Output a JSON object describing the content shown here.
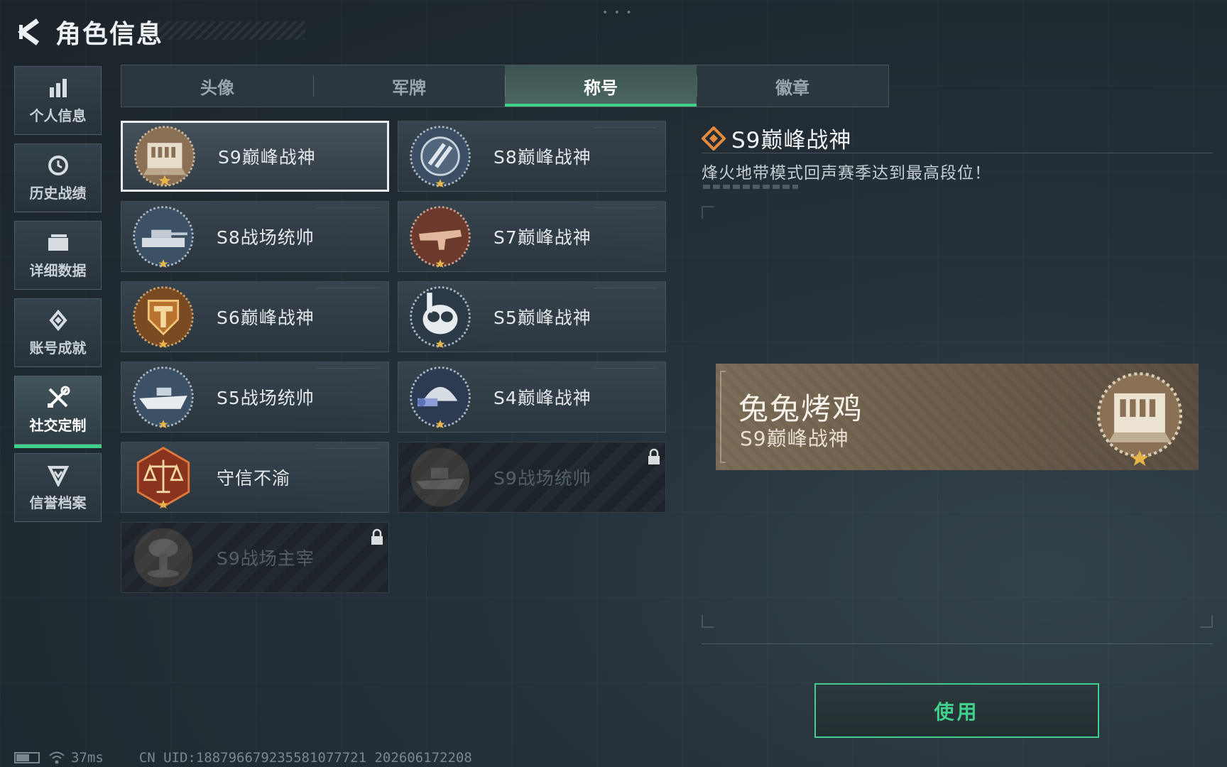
{
  "header": {
    "title": "角色信息"
  },
  "sidebar": {
    "items": [
      {
        "label": "个人信息",
        "icon": "bar-chart-icon"
      },
      {
        "label": "历史战绩",
        "icon": "clock-icon"
      },
      {
        "label": "详细数据",
        "icon": "folder-icon"
      },
      {
        "label": "账号成就",
        "icon": "medal-icon"
      },
      {
        "label": "社交定制",
        "icon": "tools-icon",
        "active": true
      },
      {
        "label": "信誉档案",
        "icon": "shield-check-icon"
      }
    ]
  },
  "tabs": [
    {
      "label": "头像"
    },
    {
      "label": "军牌"
    },
    {
      "label": "称号",
      "active": true
    },
    {
      "label": "徽章"
    }
  ],
  "titles": [
    {
      "label": "S9巅峰战神",
      "badge": "dam-badge-icon",
      "selected": true,
      "locked": false
    },
    {
      "label": "S8巅峰战神",
      "badge": "slash-emblem-badge-icon",
      "selected": false,
      "locked": false
    },
    {
      "label": "S8战场统帅",
      "badge": "tank-badge-icon",
      "selected": false,
      "locked": false
    },
    {
      "label": "S7巅峰战神",
      "badge": "rifle-badge-icon",
      "selected": false,
      "locked": false
    },
    {
      "label": "S6巅峰战神",
      "badge": "t-shield-badge-icon",
      "selected": false,
      "locked": false
    },
    {
      "label": "S5巅峰战神",
      "badge": "diving-mask-badge-icon",
      "selected": false,
      "locked": false
    },
    {
      "label": "S5战场统帅",
      "badge": "boat-badge-icon",
      "selected": false,
      "locked": false
    },
    {
      "label": "S4巅峰战神",
      "badge": "night-vision-helmet-badge-icon",
      "selected": false,
      "locked": false
    },
    {
      "label": "守信不渝",
      "badge": "scales-badge-icon",
      "selected": false,
      "locked": false
    },
    {
      "label": "S9战场统帅",
      "badge": "warship-badge-icon",
      "selected": false,
      "locked": true
    },
    {
      "label": "S9战场主宰",
      "badge": "mushroom-cloud-badge-icon",
      "selected": false,
      "locked": true
    }
  ],
  "detail": {
    "name": "S9巅峰战神",
    "description": "烽火地带模式回声赛季达到最高段位！",
    "preview_player_name": "兔兔烤鸡",
    "preview_title": "S9巅峰战神",
    "use_button_label": "使用"
  },
  "status": {
    "ping": "37ms",
    "uid": "CN UID:18879667923558107​7721 202606172208"
  },
  "colors": {
    "accent": "#3fd08c",
    "gold": "#e8b54a",
    "preview_bg": "#7c6d58"
  }
}
